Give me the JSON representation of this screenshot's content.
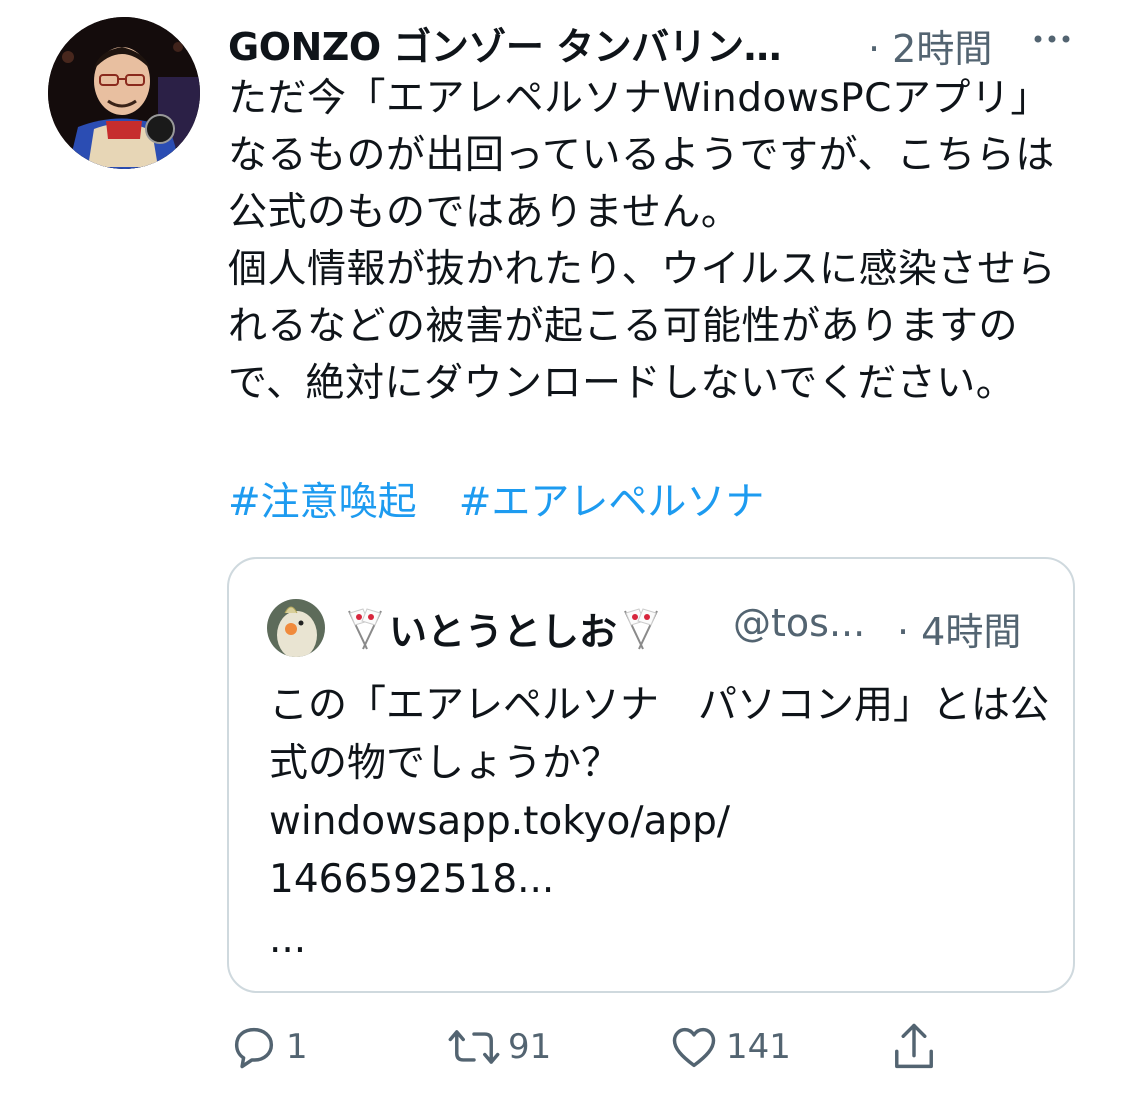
{
  "tweet": {
    "display_name": "GONZO ゴンゾー タンバリン…",
    "time": "· 2時間",
    "text": "ただ今「エアレペルソナWindowsPCアプリ」なるものが出回っているようですが、こちらは公式のものではありません。\n個人情報が抜かれたり、ウイルスに感染させられるなどの被害が起こる可能性がありますので、絶対にダウンロードしないでください。",
    "hashtags": [
      "#注意喚起",
      "#エアレペルソナ"
    ]
  },
  "quote": {
    "name": "いとうとしお",
    "handle": "@tos...",
    "time": "· 4時間",
    "text": "この「エアレペルソナ　パソコン用」とは公式の物でしょうか？\nwindowsapp.tokyo/app/\n1466592518...",
    "ellipsis": "..."
  },
  "actions": {
    "reply_count": "1",
    "retweet_count": "91",
    "like_count": "141"
  },
  "icons": [
    "more-icon",
    "reply-icon",
    "retweet-icon",
    "like-icon",
    "share-icon",
    "japan-flags-icon"
  ],
  "colors": {
    "link": "#1d9bf0",
    "secondary_text": "#536471",
    "border": "#cfd9de"
  }
}
